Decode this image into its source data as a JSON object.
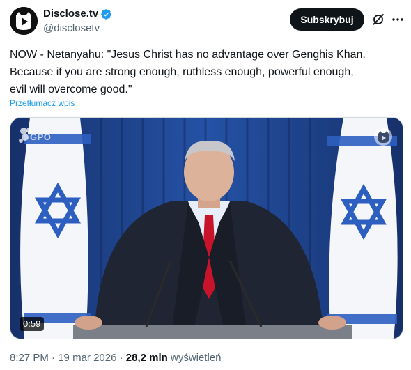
{
  "author": {
    "display_name": "Disclose.tv",
    "handle": "@disclosetv",
    "avatar_icon": "play-cat-logo-icon",
    "verified_icon": "verified-badge-icon",
    "verified_color": "#1d9bf0"
  },
  "actions": {
    "subscribe_label": "Subskrybuj",
    "grok_icon": "grok-icon",
    "more_icon": "more-options-icon"
  },
  "post": {
    "text": "NOW - Netanyahu: \"Jesus Christ has no advantage over Genghis Khan.\nBecause if you are strong enough, ruthless enough, powerful enough,\nevil will overcome good.\"",
    "translate_label": "Przetłumacz wpis"
  },
  "video": {
    "duration": "0:59",
    "watermark": "GPO",
    "channel_icon": "channel-cat-icon"
  },
  "meta": {
    "time": "8:27 PM",
    "separator": "·",
    "date": "19 mar 2026",
    "views_count": "28,2 mln",
    "views_label": "wyświetleń"
  },
  "colors": {
    "text": "#0f1419",
    "secondary": "#536471",
    "link": "#1d9bf0",
    "button_bg": "#0f1419",
    "button_text": "#ffffff"
  }
}
